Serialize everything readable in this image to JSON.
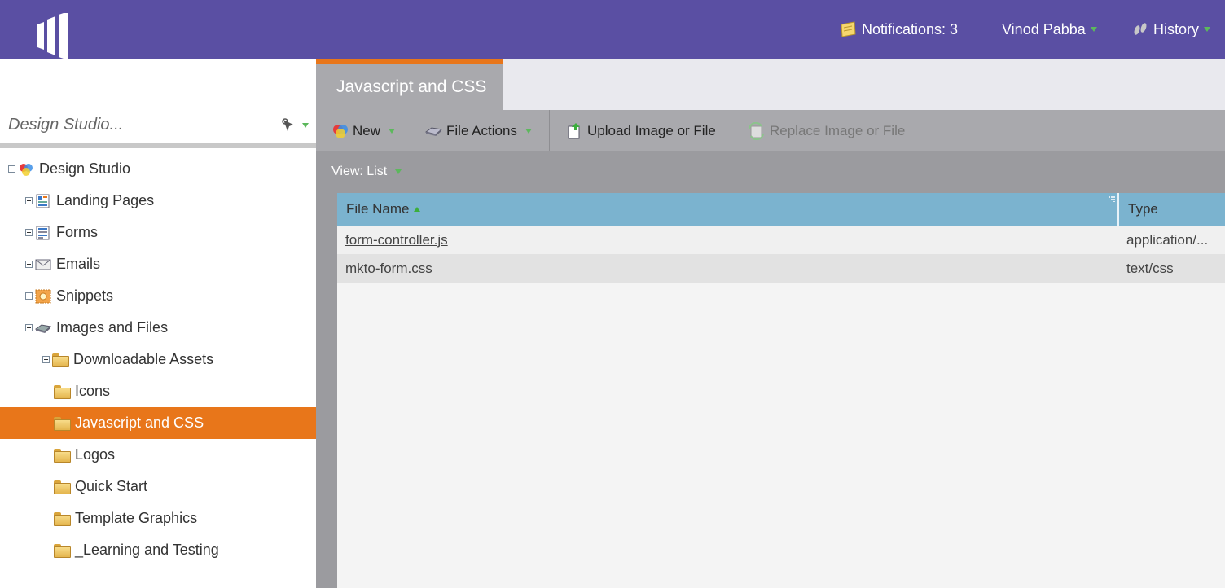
{
  "header": {
    "notifications_label": "Notifications: 3",
    "user_name": "Vinod Pabba",
    "history_label": "History"
  },
  "sidebar": {
    "search_placeholder": "Design Studio...",
    "tree": [
      {
        "label": "Design Studio",
        "icon": "design-studio-icon",
        "toggle": "minus"
      },
      {
        "label": "Landing Pages",
        "icon": "landing-pages-icon",
        "toggle": "plus"
      },
      {
        "label": "Forms",
        "icon": "forms-icon",
        "toggle": "plus"
      },
      {
        "label": "Emails",
        "icon": "emails-icon",
        "toggle": "plus"
      },
      {
        "label": "Snippets",
        "icon": "snippets-icon",
        "toggle": "plus"
      },
      {
        "label": "Images and Files",
        "icon": "images-files-icon",
        "toggle": "minus"
      },
      {
        "label": "Downloadable Assets",
        "icon": "folder-icon",
        "toggle": "plus"
      },
      {
        "label": "Icons",
        "icon": "folder-icon",
        "toggle": "none"
      },
      {
        "label": "Javascript and CSS",
        "icon": "folder-icon",
        "toggle": "none",
        "selected": true
      },
      {
        "label": "Logos",
        "icon": "folder-icon",
        "toggle": "none"
      },
      {
        "label": "Quick Start",
        "icon": "folder-icon",
        "toggle": "none"
      },
      {
        "label": "Template Graphics",
        "icon": "folder-icon",
        "toggle": "none"
      },
      {
        "label": "_Learning and Testing",
        "icon": "folder-icon",
        "toggle": "none"
      }
    ]
  },
  "main": {
    "tab_label": "Javascript and CSS",
    "toolbar": {
      "new_label": "New",
      "file_actions_label": "File Actions",
      "upload_label": "Upload Image or File",
      "replace_label": "Replace Image or File"
    },
    "view_label": "View: List",
    "grid": {
      "columns": [
        "File Name",
        "Type"
      ],
      "rows": [
        {
          "name": "form-controller.js",
          "type": "application/..."
        },
        {
          "name": "mkto-form.css",
          "type": "text/css"
        }
      ]
    }
  },
  "colors": {
    "header_purple": "#5a4fa3",
    "accent_orange": "#e8761a",
    "grid_header_blue": "#7bb3cf",
    "toolbar_gray": "#a9a9ad"
  }
}
